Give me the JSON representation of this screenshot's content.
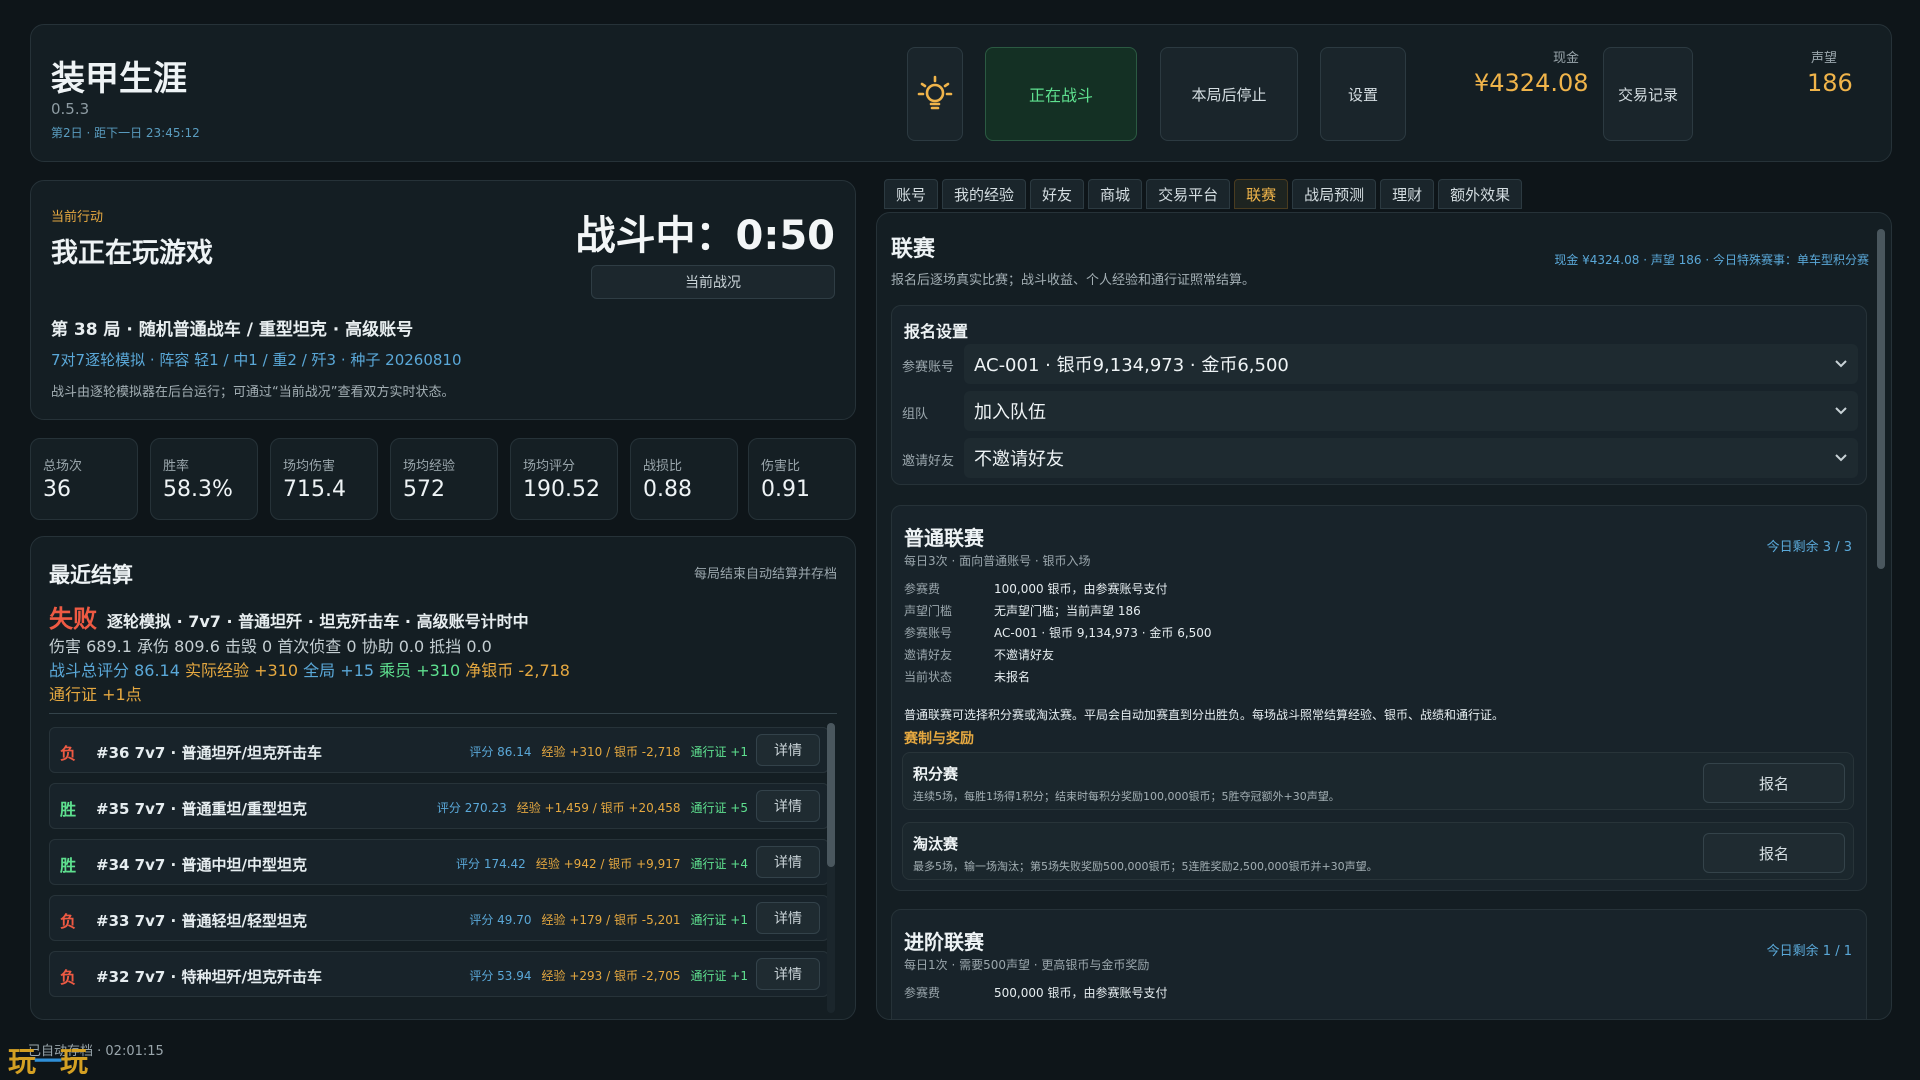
{
  "header": {
    "title": "装甲生涯",
    "version": "0.5.3",
    "day": "第2日 · 距下一日 23:45:12",
    "fight_label": "正在战斗",
    "stop_label": "本局后停止",
    "settings_label": "设置",
    "cash_label": "现金",
    "cash_value": "¥4324.08",
    "trade_log_label": "交易记录",
    "rep_label": "声望",
    "rep_value": "186",
    "accent_color": "#f0b44a"
  },
  "action": {
    "label": "当前行动",
    "title": "我正在玩游戏",
    "status": "战斗中：0:50",
    "status_button": "当前战况",
    "round": "第 38 局 · 随机普通战车 / 重型坦克 · 高级账号",
    "sub": "7对7逐轮模拟 · 阵容 轻1 / 中1 / 重2 / 歼3 · 种子 20260810",
    "note": "战斗由逐轮模拟器在后台运行；可通过“当前战况”查看双方实时状态。"
  },
  "stats": [
    {
      "label": "总场次",
      "value": "36"
    },
    {
      "label": "胜率",
      "value": "58.3%"
    },
    {
      "label": "场均伤害",
      "value": "715.4"
    },
    {
      "label": "场均经验",
      "value": "572"
    },
    {
      "label": "场均评分",
      "value": "190.52"
    },
    {
      "label": "战损比",
      "value": "0.88"
    },
    {
      "label": "伤害比",
      "value": "0.91"
    }
  ],
  "recent": {
    "title": "最近结算",
    "hint": "每局结束自动结算并存档",
    "result": "失败",
    "headline": "逐轮模拟 · 7v7 · 普通坦歼 · 坦克歼击车 · 高级账号计时中",
    "line2": "伤害 689.1  承伤 809.6  击毁 0  首次侦查 0  协助 0.0  抵挡 0.0",
    "line3_score_label": "战斗总评分",
    "line3_score": "86.14",
    "line3_exp_label": "实际经验",
    "line3_exp": "+310",
    "line3_global_label": "全局",
    "line3_global": "+15",
    "line3_crew_label": "乘员",
    "line3_crew": "+310",
    "line3_silver_label": "净银币",
    "line3_silver": "-2,718",
    "line4": "通行证 +1点",
    "detail_label": "详情",
    "rows": [
      {
        "res": "负",
        "win": false,
        "title": "#36  7v7 · 普通坦歼/坦克歼击车",
        "score": "评分 86.14",
        "exp": "经验 +310 / 银币 -2,718",
        "pass": "通行证 +1"
      },
      {
        "res": "胜",
        "win": true,
        "title": "#35  7v7 · 普通重坦/重型坦克",
        "score": "评分 270.23",
        "exp": "经验 +1,459 / 银币 +20,458",
        "pass": "通行证 +5"
      },
      {
        "res": "胜",
        "win": true,
        "title": "#34  7v7 · 普通中坦/中型坦克",
        "score": "评分 174.42",
        "exp": "经验 +942 / 银币 +9,917",
        "pass": "通行证 +4"
      },
      {
        "res": "负",
        "win": false,
        "title": "#33  7v7 · 普通轻坦/轻型坦克",
        "score": "评分 49.70",
        "exp": "经验 +179 / 银币 -5,201",
        "pass": "通行证 +1"
      },
      {
        "res": "负",
        "win": false,
        "title": "#32  7v7 · 特种坦歼/坦克歼击车",
        "score": "评分 53.94",
        "exp": "经验 +293 / 银币 -2,705",
        "pass": "通行证 +1"
      }
    ]
  },
  "tabs": [
    "账号",
    "我的经验",
    "好友",
    "商城",
    "交易平台",
    "联赛",
    "战局预测",
    "理财",
    "额外效果"
  ],
  "active_tab": 5,
  "league": {
    "title": "联赛",
    "desc": "报名后逐场真实比赛；战斗收益、个人经验和通行证照常结算。",
    "meta": "现金 ¥4324.08 · 声望 186 · 今日特殊赛事：单车型积分赛",
    "signup_settings": {
      "title": "报名设置",
      "account_label": "参赛账号",
      "account_value": "AC-001 · 银币9,134,973 · 金币6,500",
      "team_label": "组队",
      "team_value": "加入队伍",
      "invite_label": "邀请好友",
      "invite_value": "不邀请好友"
    },
    "normal": {
      "title": "普通联赛",
      "subtitle": "每日3次 · 面向普通账号 · 银币入场",
      "quota": "今日剩余 3 / 3",
      "kv": [
        {
          "k": "参赛费",
          "v": "100,000 银币，由参赛账号支付"
        },
        {
          "k": "声望门槛",
          "v": "无声望门槛；当前声望 186"
        },
        {
          "k": "参赛账号",
          "v": "AC-001 · 银币 9,134,973 · 金币 6,500"
        },
        {
          "k": "邀请好友",
          "v": "不邀请好友"
        },
        {
          "k": "当前状态",
          "v": "未报名"
        }
      ],
      "desc": "普通联赛可选择积分赛或淘汰赛。平局会自动加赛直到分出胜负。每场战斗照常结算经验、银币、战绩和通行证。",
      "reward_title": "赛制与奖励",
      "modes": [
        {
          "name": "积分赛",
          "desc": "连续5场，每胜1场得1积分；结束时每积分奖励100,000银币；5胜夺冠额外+30声望。",
          "button": "报名"
        },
        {
          "name": "淘汰赛",
          "desc": "最多5场，输一场淘汰；第5场失败奖励500,000银币；5连胜奖励2,500,000银币并+30声望。",
          "button": "报名"
        }
      ]
    },
    "advanced": {
      "title": "进阶联赛",
      "subtitle": "每日1次 · 需要500声望 · 更高银币与金币奖励",
      "quota": "今日剩余 1 / 1",
      "fee_label": "参赛费",
      "fee_value": "500,000 银币，由参赛账号支付"
    }
  },
  "footer": {
    "logo_a": "玩",
    "logo_b": "一",
    "logo_c": "玩",
    "saved": "已自动存档 · 02:01:15"
  }
}
